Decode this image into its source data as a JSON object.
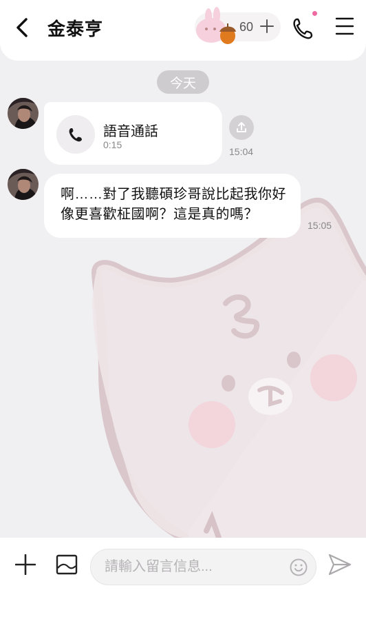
{
  "header": {
    "title": "金泰亨",
    "acorn_count": "60",
    "icons": {
      "back": "chevron-left-icon",
      "add": "plus-icon",
      "call": "phone-icon",
      "menu": "menu-icon"
    }
  },
  "chat": {
    "date_label": "今天",
    "messages": [
      {
        "type": "voice_call",
        "title": "語音通話",
        "duration": "0:15",
        "time": "15:04"
      },
      {
        "type": "text",
        "text": "啊……對了我聽碩珍哥說比起我你好像更喜歡柾國啊？這是真的嗎？",
        "time": "15:05"
      }
    ]
  },
  "composer": {
    "placeholder": "請輸入留言信息...",
    "value": ""
  },
  "colors": {
    "accent": "#ee6aa1",
    "background": "#f0eff1",
    "bubble": "#ffffff"
  }
}
